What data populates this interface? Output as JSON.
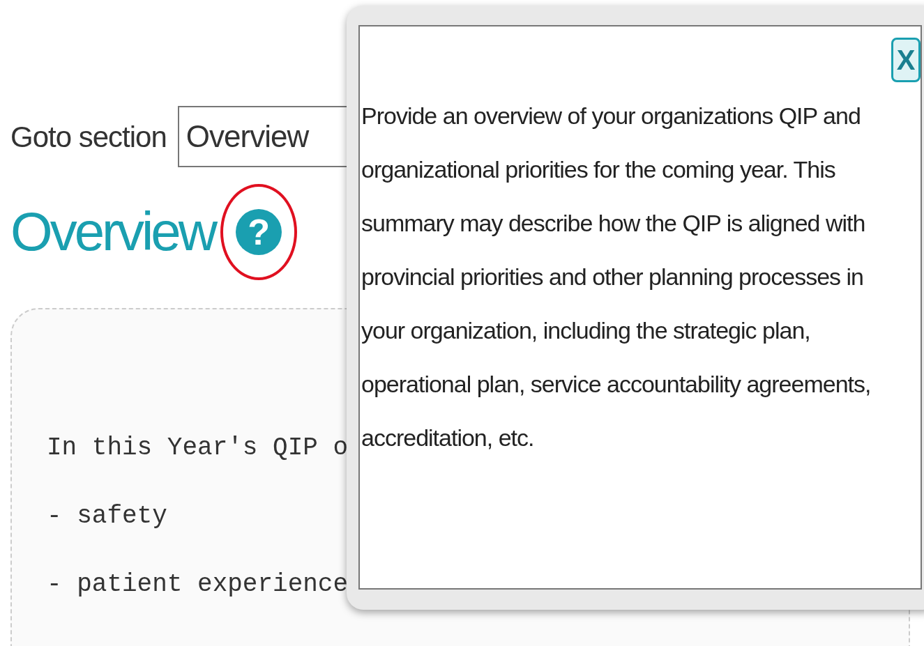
{
  "goto": {
    "label": "Goto section",
    "value": "Overview"
  },
  "section": {
    "title": "Overview",
    "help_icon": "?",
    "help_highlighted": true
  },
  "content_lines": [
    "In this Year's QIP o",
    "- safety",
    "- patient experience"
  ],
  "popup": {
    "close": "X",
    "text": "Provide an overview of your organizations QIP and organizational priorities for the coming year. This summary may describe how the QIP is aligned with provincial priorities and other planning processes in your organization, including the strategic plan, operational plan, service accountability agreements, accreditation, etc."
  }
}
